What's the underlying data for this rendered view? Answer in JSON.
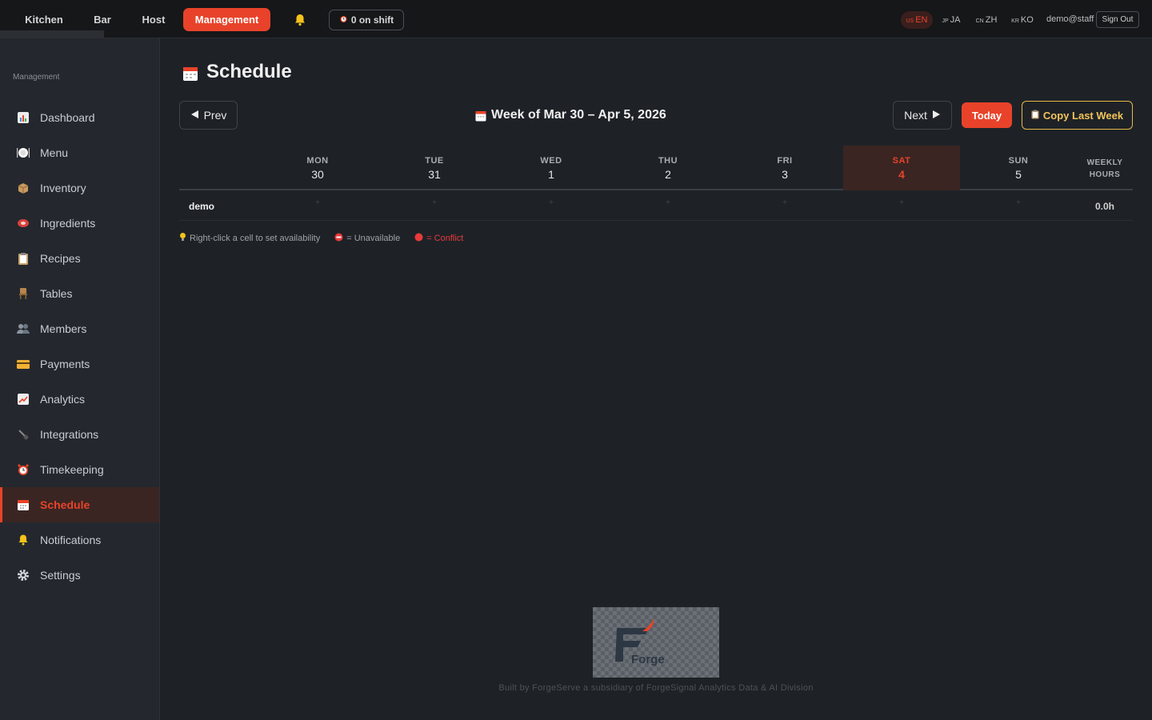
{
  "topbar": {
    "tabs": [
      "Kitchen",
      "Bar",
      "Host",
      "Management"
    ],
    "shift_label": "0 on shift",
    "languages": [
      {
        "code": "US",
        "label": "EN"
      },
      {
        "code": "JP",
        "label": "JA"
      },
      {
        "code": "CN",
        "label": "ZH"
      },
      {
        "code": "KR",
        "label": "KO"
      }
    ],
    "user": "demo@staff",
    "signout_label": "Sign Out"
  },
  "sidebar": {
    "heading": "Management",
    "items": [
      {
        "label": "Dashboard",
        "icon": "chart-icon"
      },
      {
        "label": "Menu",
        "icon": "plate-icon"
      },
      {
        "label": "Inventory",
        "icon": "box-icon"
      },
      {
        "label": "Ingredients",
        "icon": "meat-icon"
      },
      {
        "label": "Recipes",
        "icon": "clipboard-icon"
      },
      {
        "label": "Tables",
        "icon": "chair-icon"
      },
      {
        "label": "Members",
        "icon": "people-icon"
      },
      {
        "label": "Payments",
        "icon": "card-icon"
      },
      {
        "label": "Analytics",
        "icon": "trend-icon"
      },
      {
        "label": "Integrations",
        "icon": "plug-icon"
      },
      {
        "label": "Timekeeping",
        "icon": "alarm-icon"
      },
      {
        "label": "Schedule",
        "icon": "calendar-icon"
      },
      {
        "label": "Notifications",
        "icon": "bell-icon"
      },
      {
        "label": "Settings",
        "icon": "gear-icon"
      }
    ],
    "active": "Schedule"
  },
  "main": {
    "title": "Schedule",
    "prev_label": "Prev",
    "week_label": "Week of Mar 30 – Apr 5, 2026",
    "next_label": "Next",
    "today_label": "Today",
    "copy_label": "Copy Last Week",
    "days": [
      {
        "name": "MON",
        "date": "30"
      },
      {
        "name": "TUE",
        "date": "31"
      },
      {
        "name": "WED",
        "date": "1"
      },
      {
        "name": "THU",
        "date": "2"
      },
      {
        "name": "FRI",
        "date": "3"
      },
      {
        "name": "SAT",
        "date": "4",
        "today": true
      },
      {
        "name": "SUN",
        "date": "5"
      }
    ],
    "weekly_hours_label_1": "WEEKLY",
    "weekly_hours_label_2": "HOURS",
    "rows": [
      {
        "name": "demo",
        "cells": [
          "+",
          "+",
          "+",
          "+",
          "+",
          "+",
          "+"
        ],
        "hours": "0.0h"
      }
    ],
    "legend": {
      "hint": "Right-click a cell to set availability",
      "unavailable": "= Unavailable",
      "conflict": "= Conflict"
    }
  },
  "footer": {
    "logo_text": "Forge",
    "credit": "Built by ForgeServe a subsidiary of ForgeSignal Analytics Data & AI Division"
  },
  "colors": {
    "accent": "#e8432a",
    "copy_button": "#f2c35a",
    "conflict": "#e83a3a",
    "background": "#1e2227",
    "sidebar": "#24282e"
  }
}
